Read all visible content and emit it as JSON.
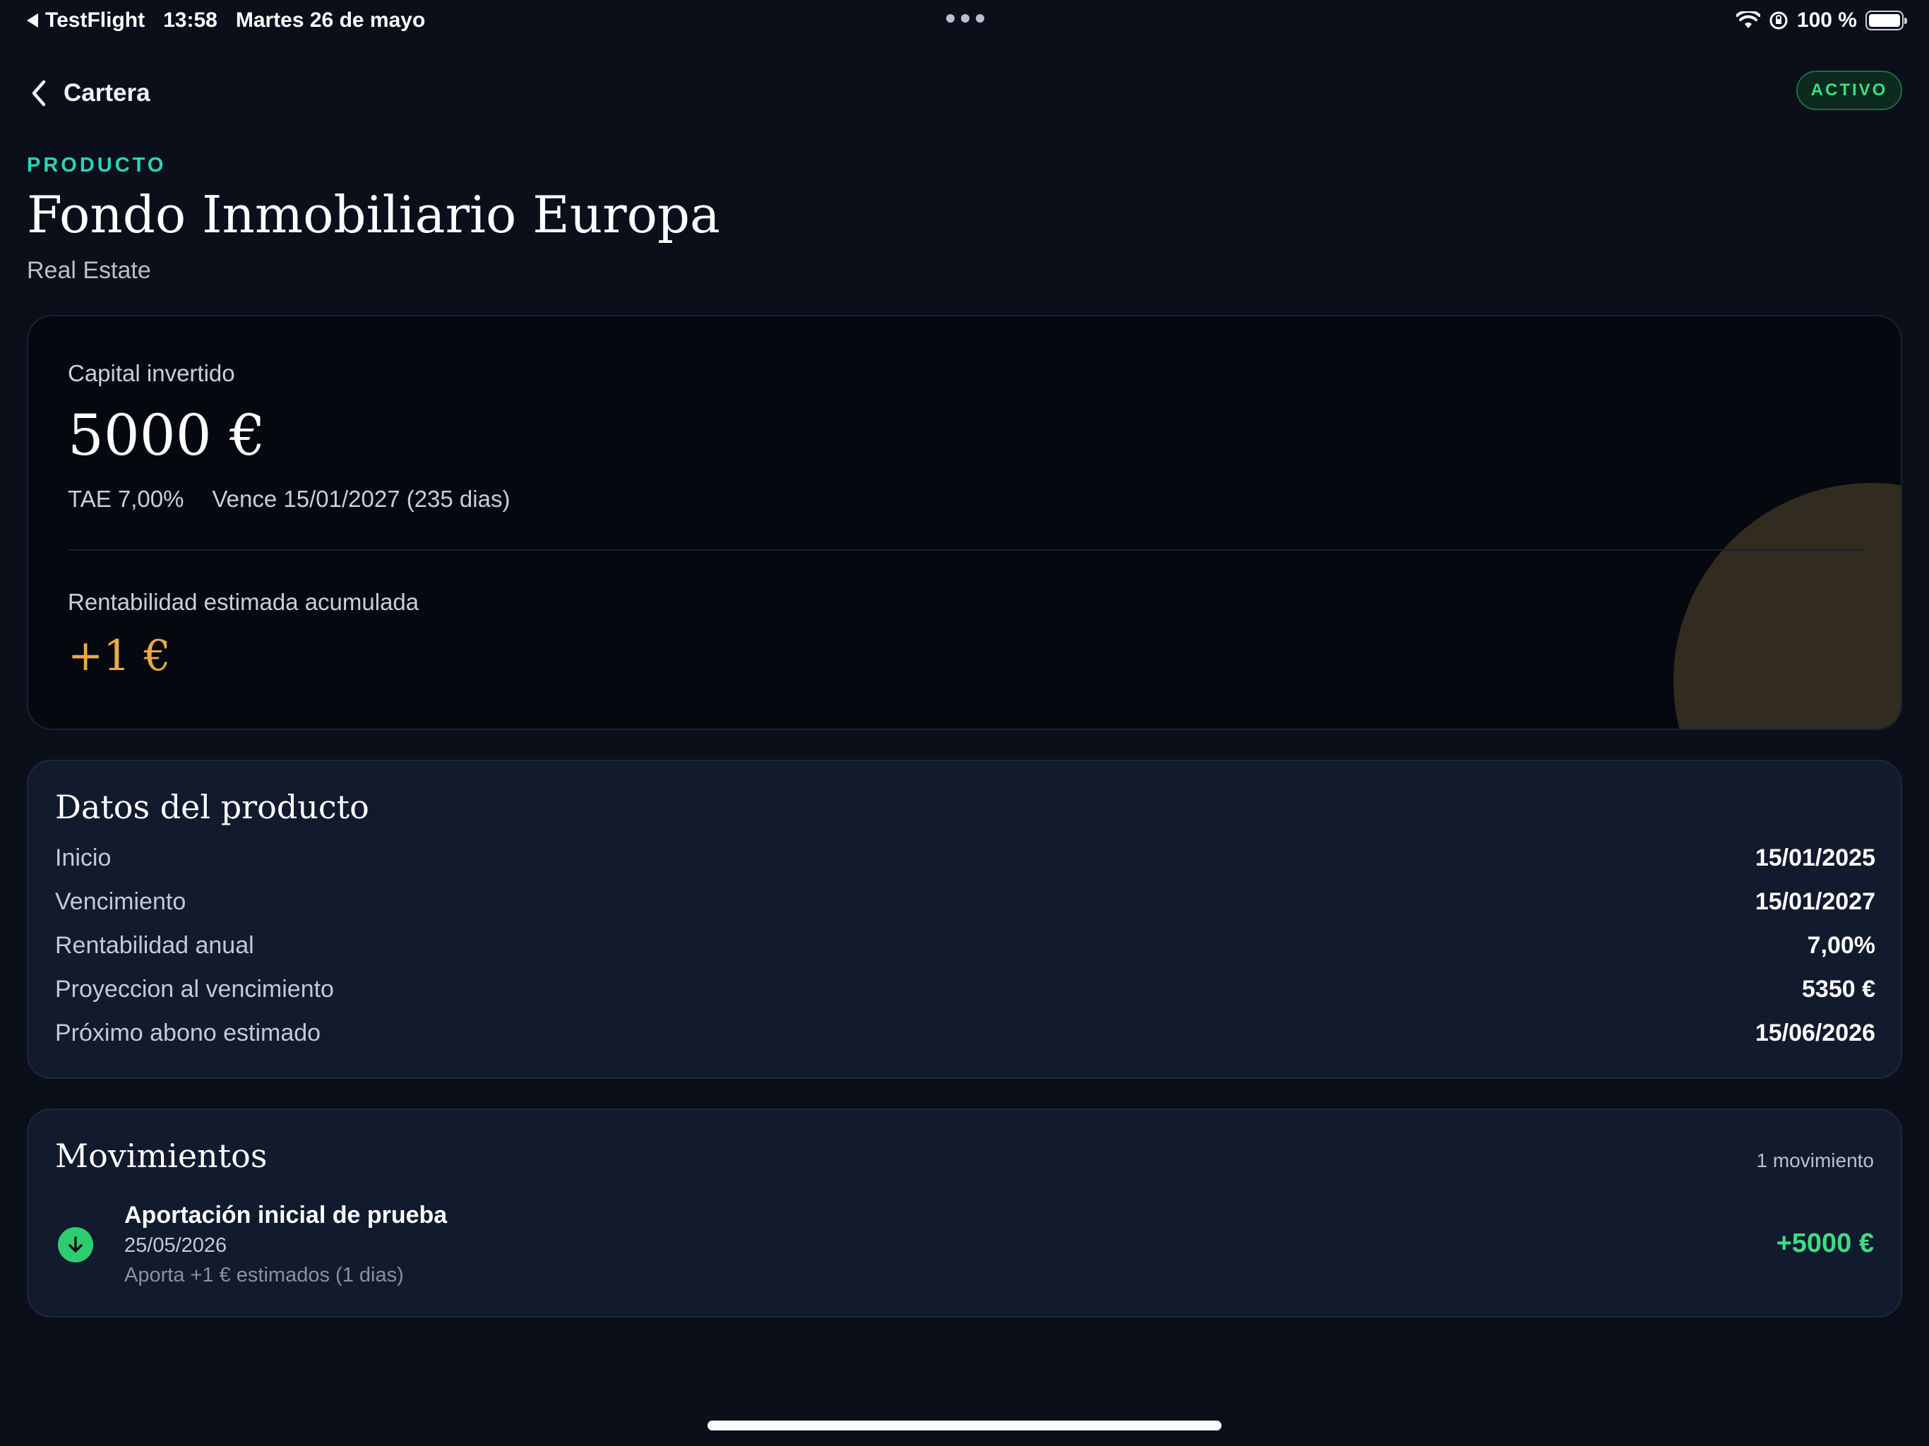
{
  "status_bar": {
    "back_app": "TestFlight",
    "time": "13:58",
    "date": "Martes 26 de mayo",
    "battery": "100 %"
  },
  "nav": {
    "back_label": "Cartera",
    "status_badge": "ACTIVO"
  },
  "header": {
    "eyebrow": "PRODUCTO",
    "title": "Fondo Inmobiliario Europa",
    "category": "Real Estate"
  },
  "summary": {
    "capital_label": "Capital invertido",
    "capital_value": "5000 €",
    "tae": "TAE 7,00%",
    "maturity": "Vence 15/01/2027 (235 dias)",
    "yield_label": "Rentabilidad estimada acumulada",
    "yield_value": "+1 €"
  },
  "details": {
    "title": "Datos del producto",
    "rows": [
      {
        "label": "Inicio",
        "value": "15/01/2025"
      },
      {
        "label": "Vencimiento",
        "value": "15/01/2027"
      },
      {
        "label": "Rentabilidad anual",
        "value": "7,00%"
      },
      {
        "label": "Proyeccion al vencimiento",
        "value": "5350 €"
      },
      {
        "label": "Próximo abono estimado",
        "value": "15/06/2026"
      }
    ]
  },
  "movements": {
    "title": "Movimientos",
    "count": "1 movimiento",
    "items": [
      {
        "title": "Aportación inicial de prueba",
        "date": "25/05/2026",
        "note": "Aporta +1 € estimados (1 dias)",
        "amount": "+5000 €"
      }
    ]
  },
  "colors": {
    "background": "#0a0f1a",
    "accent_teal": "#2bd4b8",
    "positive_green": "#3ddc84",
    "yield_gold": "#e8a94a"
  }
}
